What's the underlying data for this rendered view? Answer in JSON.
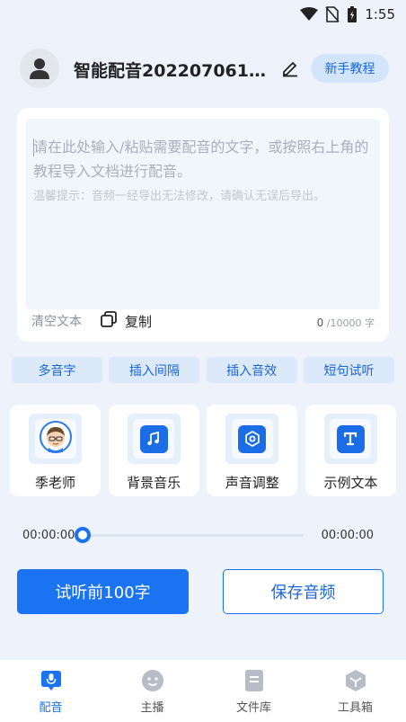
{
  "status_bar": {
    "time": "1:55",
    "icons": [
      "wifi-icon",
      "no-sim-icon",
      "battery-charging-icon"
    ]
  },
  "header": {
    "title": "智能配音20220706135...",
    "tutorial_label": "新手教程",
    "icons": [
      "user-avatar-icon",
      "pencil-icon"
    ]
  },
  "editor": {
    "placeholder": "请在此处输入/粘贴需要配音的文字，或按照右上角的教程导入文档进行配音。",
    "hint": "温馨提示：音频一经导出无法修改，请确认无误后导出。",
    "clear_label": "清空文本",
    "copy_label": "复制",
    "char_count": "0",
    "char_limit": "/10000 字"
  },
  "chips": [
    "多音字",
    "插入间隔",
    "插入音效",
    "短句试听"
  ],
  "tools": [
    {
      "label": "季老师",
      "icon": "voice-actor-avatar"
    },
    {
      "label": "背景音乐",
      "icon": "music-note-icon"
    },
    {
      "label": "声音调整",
      "icon": "settings-gear-icon"
    },
    {
      "label": "示例文本",
      "icon": "text-t-icon"
    }
  ],
  "player": {
    "current_time": "00:00:00",
    "total_time": "00:00:00",
    "progress": 0
  },
  "actions": {
    "preview_label": "试听前100字",
    "save_label": "保存音频"
  },
  "tabbar": {
    "active_index": 0,
    "tabs": [
      {
        "label": "配音",
        "icon": "microphone-icon"
      },
      {
        "label": "主播",
        "icon": "face-icon"
      },
      {
        "label": "文件库",
        "icon": "folder-icon"
      },
      {
        "label": "工具箱",
        "icon": "toolbox-icon"
      }
    ]
  },
  "colors": {
    "accent": "#1a73f0",
    "chip_bg": "#dce9fb",
    "page_bg": "#eef3fb"
  }
}
